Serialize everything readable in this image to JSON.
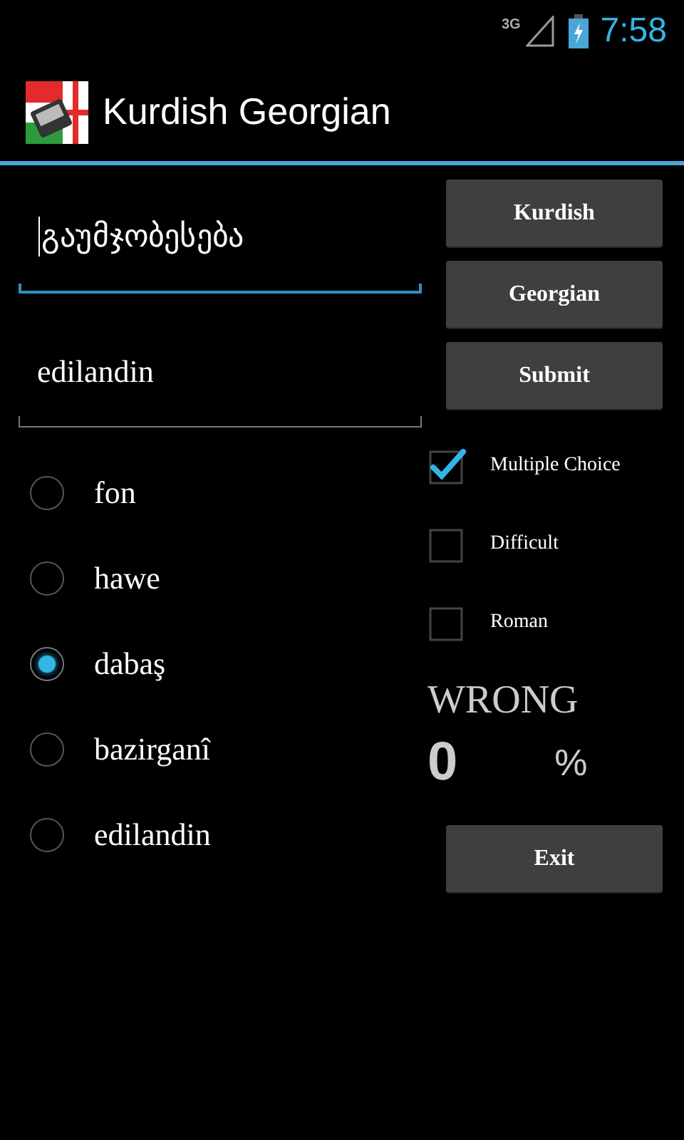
{
  "status_bar": {
    "network": "3G",
    "time": "7:58"
  },
  "action_bar": {
    "title": "Kurdish Georgian"
  },
  "fields": [
    {
      "value": "გაუმჯობესება",
      "focused": true
    },
    {
      "value": "edilandin",
      "focused": false
    }
  ],
  "buttons": [
    "Kurdish",
    "Georgian",
    "Submit"
  ],
  "answers": [
    {
      "label": "fon",
      "selected": false
    },
    {
      "label": "hawe",
      "selected": false
    },
    {
      "label": "dabaş",
      "selected": true
    },
    {
      "label": "bazirganî",
      "selected": false
    },
    {
      "label": "edilandin",
      "selected": false
    }
  ],
  "options": [
    {
      "label": "Multiple Choice",
      "checked": true
    },
    {
      "label": "Difficult",
      "checked": false
    },
    {
      "label": "Roman",
      "checked": false
    }
  ],
  "result": {
    "verdict": "WRONG",
    "score": "0",
    "unit": "%"
  },
  "exit_button": "Exit"
}
